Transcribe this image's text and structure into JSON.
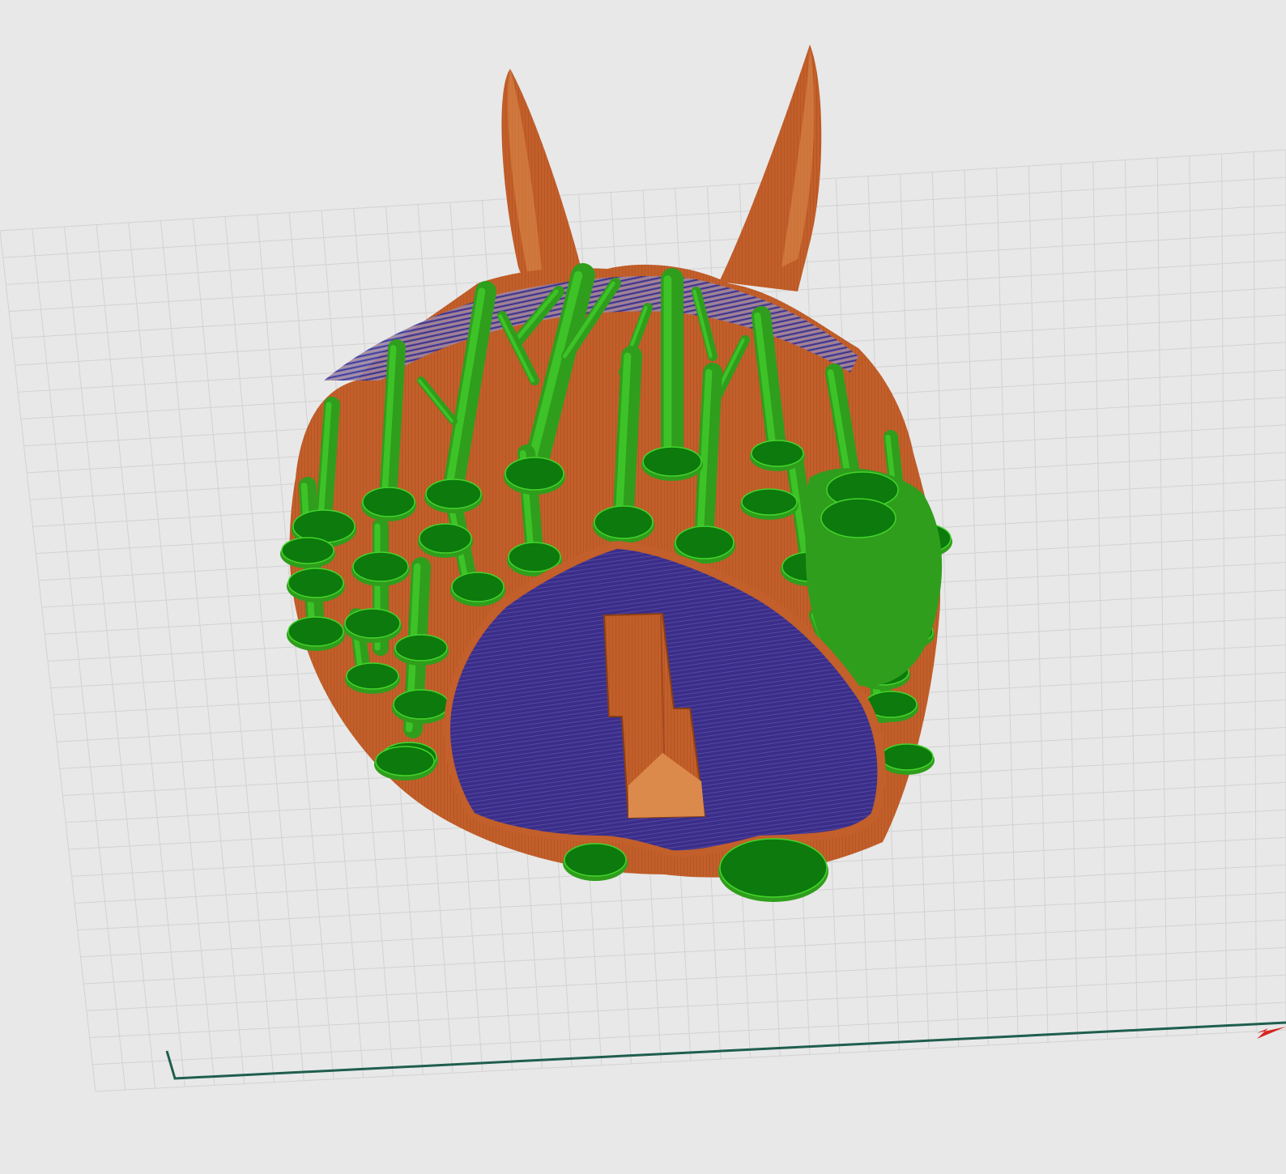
{
  "viewport": {
    "background_color": "#e8e8e8",
    "grid_color": "#d2d2d2",
    "build_plate_edge_color": "#1f5e4e",
    "axis_arrow_color": "#d8231e"
  },
  "model": {
    "shell_color": "#c25f2a",
    "shell_highlight_color": "#dc8a4c",
    "infill_color": "#3a2e8a",
    "support_color": "#2f9e1c",
    "support_highlight_color": "#44d42c",
    "support_dark_color": "#0c7a0c",
    "icons": [
      "slice-preview-model",
      "support-tree-icon",
      "axis-arrow-icon"
    ]
  }
}
